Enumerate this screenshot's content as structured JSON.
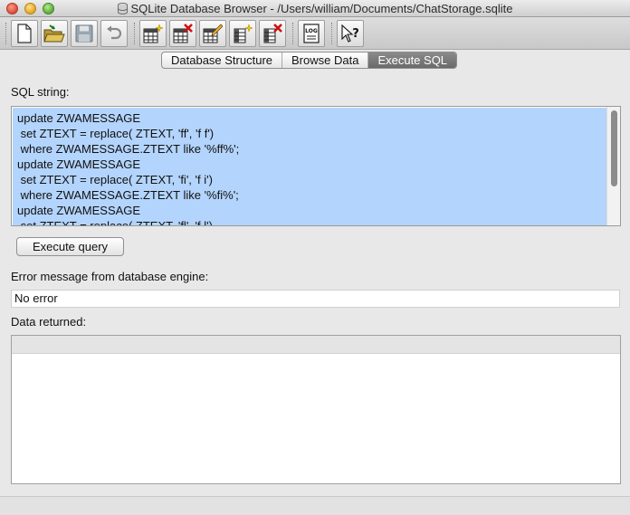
{
  "window": {
    "title": "SQLite Database Browser - /Users/william/Documents/ChatStorage.sqlite"
  },
  "toolbar": {
    "buttons": [
      {
        "name": "new-database",
        "icon": "new-document-icon"
      },
      {
        "name": "open-database",
        "icon": "open-folder-icon"
      },
      {
        "name": "save-database",
        "icon": "floppy-disk-icon"
      },
      {
        "name": "undo",
        "icon": "undo-arrow-icon"
      },
      {
        "name": "create-table",
        "icon": "table-add-icon"
      },
      {
        "name": "delete-table",
        "icon": "table-delete-icon"
      },
      {
        "name": "modify-table",
        "icon": "table-edit-icon"
      },
      {
        "name": "create-index",
        "icon": "index-add-icon"
      },
      {
        "name": "delete-index",
        "icon": "index-delete-icon"
      },
      {
        "name": "sql-log",
        "icon": "log-icon",
        "text": "LOG"
      },
      {
        "name": "whats-this",
        "icon": "whats-this-icon",
        "text": "?"
      }
    ]
  },
  "tabs": [
    {
      "label": "Database Structure",
      "active": false
    },
    {
      "label": "Browse Data",
      "active": false
    },
    {
      "label": "Execute SQL",
      "active": true
    }
  ],
  "main": {
    "sql_label": "SQL string:",
    "sql_text": "update ZWAMESSAGE\n set ZTEXT = replace( ZTEXT, 'ff', 'f f')\n where ZWAMESSAGE.ZTEXT like '%ff%';\nupdate ZWAMESSAGE\n set ZTEXT = replace( ZTEXT, 'fi', 'f i')\n where ZWAMESSAGE.ZTEXT like '%fi%';\nupdate ZWAMESSAGE\n set ZTEXT = replace( ZTEXT, 'fl', 'f l')",
    "execute_label": "Execute query",
    "error_label": "Error message from database engine:",
    "error_value": "No error",
    "data_label": "Data returned:"
  },
  "colors": {
    "selection": "#b3d4fc",
    "active_tab": "#7a7a7a"
  }
}
